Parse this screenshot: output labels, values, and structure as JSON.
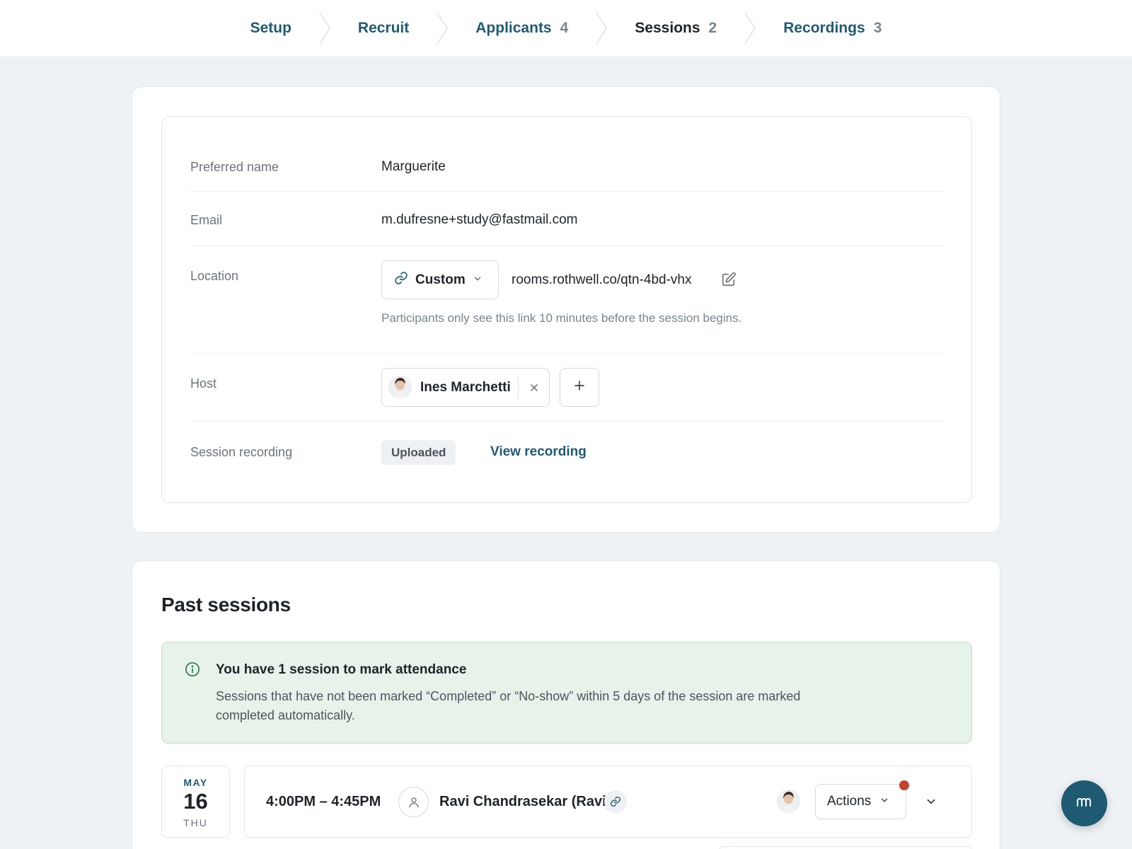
{
  "stepper": {
    "steps": [
      {
        "label": "Setup",
        "count": ""
      },
      {
        "label": "Recruit",
        "count": ""
      },
      {
        "label": "Applicants",
        "count": "4"
      },
      {
        "label": "Sessions",
        "count": "2"
      },
      {
        "label": "Recordings",
        "count": "3"
      }
    ],
    "active": "Sessions"
  },
  "details": {
    "preferred_name": {
      "label": "Preferred name",
      "value": "Marguerite"
    },
    "email": {
      "label": "Email",
      "value": "m.dufresne+study@fastmail.com"
    },
    "location": {
      "label": "Location",
      "type": "Custom",
      "url": "rooms.rothwell.co/qtn-4bd-vhx",
      "hint": "Participants only see this link 10 minutes before the session begins."
    },
    "host": {
      "label": "Host",
      "name": "Ines Marchetti"
    },
    "recording": {
      "label": "Session recording",
      "status": "Uploaded",
      "link": "View recording"
    }
  },
  "past": {
    "title": "Past sessions",
    "notice": {
      "title": "You have 1 session to mark attendance",
      "body": "Sessions that have not been marked “Completed” or “No-show” within 5 days of the session are marked completed automatically."
    },
    "session": {
      "month": "MAY",
      "day": "16",
      "dow": "THU",
      "time": "4:00PM – 4:45PM",
      "participant": "Ravi Chandrasekar (Ravi)",
      "actions_label": "Actions"
    }
  },
  "colors": {
    "accent": "#1f5a73",
    "notice_bg": "#e6f2ea",
    "alert_dot": "#c0432a"
  },
  "icons": [
    "link-icon",
    "chevron-down-icon",
    "edit-icon",
    "close-icon",
    "plus-icon",
    "info-icon",
    "person-icon",
    "logo-icon"
  ]
}
